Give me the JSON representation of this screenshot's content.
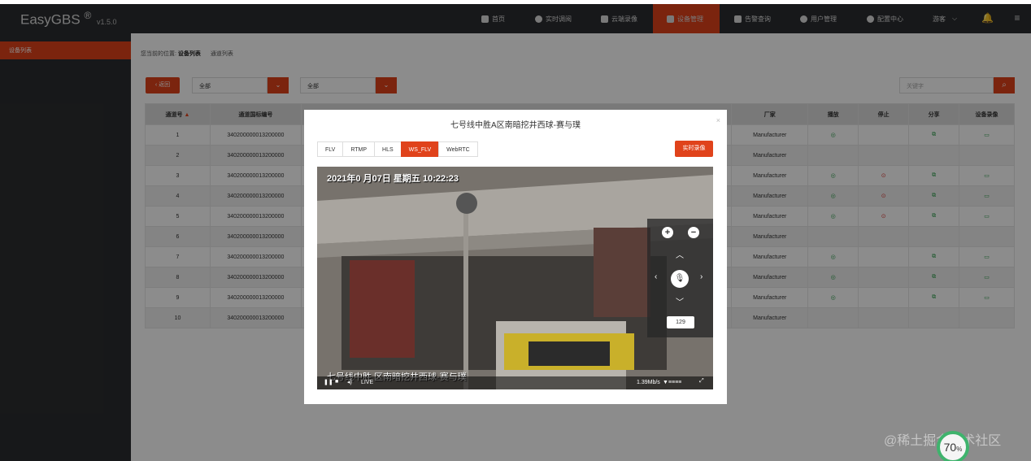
{
  "app": {
    "name": "EasyGBS",
    "reg": "®",
    "version": "v1.5.0"
  },
  "nav": {
    "items": [
      {
        "label": "首页",
        "icon": "cloud-icon"
      },
      {
        "label": "实时调阅",
        "icon": "play-circle-icon"
      },
      {
        "label": "云端录像",
        "icon": "video-camera-icon"
      },
      {
        "label": "设备管理",
        "icon": "device-icon",
        "active": true
      },
      {
        "label": "告警查询",
        "icon": "bank-icon"
      },
      {
        "label": "用户管理",
        "icon": "user-icon"
      },
      {
        "label": "配置中心",
        "icon": "gear-icon"
      }
    ],
    "user": "游客"
  },
  "sidebar": {
    "items": [
      {
        "label": "设备列表"
      }
    ]
  },
  "breadcrumb": {
    "prefix": "您当前的位置:",
    "current": "设备列表",
    "next": "通道列表"
  },
  "toolbar": {
    "back": "返回",
    "filter1": "全部",
    "filter2": "全部",
    "search_placeholder": "关键字"
  },
  "table": {
    "headers": [
      "通道号",
      "通道国标编号",
      "厂家",
      "播放",
      "停止",
      "分享",
      "设备录像"
    ],
    "rows": [
      {
        "id": "1",
        "code": "340200000013200000",
        "maker": "Manufacturer",
        "play": true,
        "stop": false
      },
      {
        "id": "2",
        "code": "340200000013200000",
        "maker": "Manufacturer",
        "play": false,
        "stop": false
      },
      {
        "id": "3",
        "code": "340200000013200000",
        "maker": "Manufacturer",
        "play": true,
        "stop": true
      },
      {
        "id": "4",
        "code": "340200000013200000",
        "maker": "Manufacturer",
        "play": true,
        "stop": true
      },
      {
        "id": "5",
        "code": "340200000013200000",
        "maker": "Manufacturer",
        "play": true,
        "stop": true
      },
      {
        "id": "6",
        "code": "340200000013200000",
        "maker": "Manufacturer",
        "play": false,
        "stop": false
      },
      {
        "id": "7",
        "code": "340200000013200000",
        "maker": "Manufacturer",
        "play": true,
        "stop": false
      },
      {
        "id": "8",
        "code": "340200000013200000",
        "maker": "Manufacturer",
        "play": true,
        "stop": false
      },
      {
        "id": "9",
        "code": "340200000013200000",
        "maker": "Manufacturer",
        "play": true,
        "stop": false
      },
      {
        "id": "10",
        "code": "340200000013200000",
        "maker": "Manufacturer",
        "play": false,
        "stop": false
      }
    ]
  },
  "modal": {
    "title": "七号线中胜A区南暗挖井西球-赛与璞",
    "close": "×",
    "tabs": [
      {
        "label": "FLV"
      },
      {
        "label": "RTMP"
      },
      {
        "label": "HLS"
      },
      {
        "label": "WS_FLV",
        "active": true
      },
      {
        "label": "WebRTC"
      }
    ],
    "record_button": "实时录像",
    "video": {
      "timestamp": "2021年0 月07日 星期五 10:22:23",
      "osd_name": "七号线中胜 区南暗挖井西球-赛与璞",
      "live": "LIVE",
      "bitrate": "1.39Mb/s",
      "ptz_speed": "129"
    }
  },
  "watermark": "@稀土掘金技术社区",
  "badge": {
    "value": "70",
    "unit": "%"
  }
}
